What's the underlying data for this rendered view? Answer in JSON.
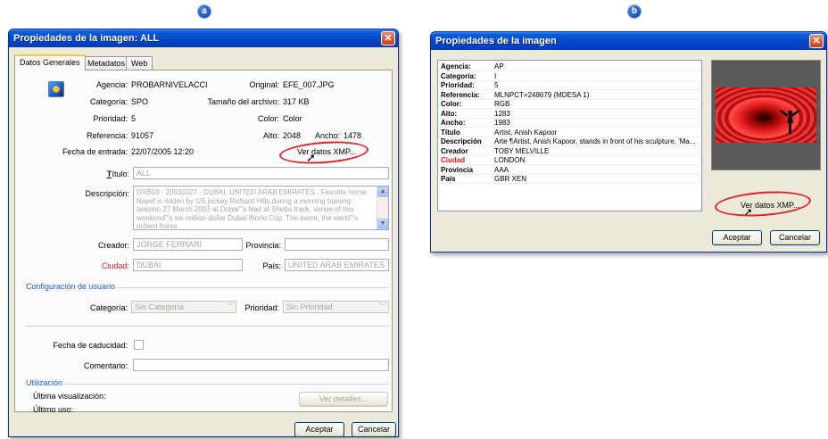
{
  "markers": {
    "a": "a",
    "b": "b"
  },
  "colors": {
    "titlebar": "#0548c9",
    "highlight": "#e0242b",
    "group_title": "#1f56c8",
    "ciudad_label": "#d0201f"
  },
  "window_a": {
    "title": "Propiedades de la imagen: ALL",
    "close_icon": "close-icon",
    "tabs": [
      "Datos Generales",
      "Metadatos",
      "Web"
    ],
    "info": {
      "agencia_label": "Agencia:",
      "agencia_value": "PROBARNIVELACCI",
      "categoria_label": "Categoría:",
      "categoria_value": "SPO",
      "prioridad_label": "Prioridad:",
      "prioridad_value": "5",
      "referencia_label": "Referencia:",
      "referencia_value": "91057",
      "fecha_label": "Fecha de entrada:",
      "fecha_value": "22/07/2005 12:20",
      "original_label": "Original:",
      "original_value": "EFE_007.JPG",
      "tamano_label": "Tamaño del archivo:",
      "tamano_value": "317 KB",
      "color_label": "Color:",
      "color_value": "Color",
      "alto_label": "Alto:",
      "alto_value": "2048",
      "ancho_label": "Ancho:",
      "ancho_value": "1478",
      "ver_xmp_label": "Ver datos XMP..."
    },
    "form": {
      "titulo_label": "Título:",
      "titulo_value": "ALL",
      "descripcion_label": "Descripción:",
      "descripcion_value": "DXB03 - 20030327 - DUBAI, UNITED ARAB EMIRATES : Favorite horse Nayef is ridden by US jockey Richard Hills during a morning training session 27 March 2003 at Dubai\"'s Nad al-Sheba track, venue of this weekend\"'s six-million-dollar Dubai World Cup. The event, the world\"'s richest horse",
      "creador_label": "Creador:",
      "creador_value": "JORGE FERRARI",
      "provincia_label": "Provincia:",
      "provincia_value": "",
      "ciudad_label": "Ciudad:",
      "ciudad_value": "DUBAI",
      "pais_label": "País:",
      "pais_value": "UNITED ARAB EMIRATES"
    },
    "config": {
      "group_title": "Configuración de usuario",
      "categoria_label": "Categoría:",
      "categoria_value": "Sin Categoría",
      "prioridad_label": "Prioridad:",
      "prioridad_value": "Sin Prioridad"
    },
    "caducidad_label": "Fecha de caducidad:",
    "comentario_label": "Comentario:",
    "utilizacion": {
      "group_title": "Utilización",
      "ultima_vis_label": "Última visualización:",
      "ultimo_uso_label": "Último uso:",
      "ver_detalles_label": "Ver detalles..."
    },
    "buttons": {
      "aceptar": "Aceptar",
      "cancelar": "Cancelar"
    }
  },
  "window_b": {
    "title": "Propiedades de la imagen",
    "close_icon": "close-icon",
    "rows": [
      {
        "key": "Agencia:",
        "value": "AP"
      },
      {
        "key": "Categoría:",
        "value": "I"
      },
      {
        "key": "Prioridad:",
        "value": "5"
      },
      {
        "key": "Referencia:",
        "value": "MLNPCT=248679 (MDESA 1)"
      },
      {
        "key": "Color:",
        "value": "RGB"
      },
      {
        "key": "Alto:",
        "value": "1283"
      },
      {
        "key": "Ancho:",
        "value": "1983"
      },
      {
        "key": "Título",
        "value": "Artist, Anish Kapoor"
      },
      {
        "key": "Descripción",
        "value": "Arte ¶Artist, Anish Kapoor, stands in front of his sculpture, 'Ma..."
      },
      {
        "key": "Creador",
        "value": "TOBY MELVILLE"
      },
      {
        "key": "Ciudad",
        "value": "LONDON"
      },
      {
        "key": "Provincia",
        "value": "AAA"
      },
      {
        "key": "País",
        "value": "GBR XEN"
      }
    ],
    "ver_xmp_label": "Ver datos XMP...",
    "buttons": {
      "aceptar": "Aceptar",
      "cancelar": "Cancelar"
    }
  }
}
